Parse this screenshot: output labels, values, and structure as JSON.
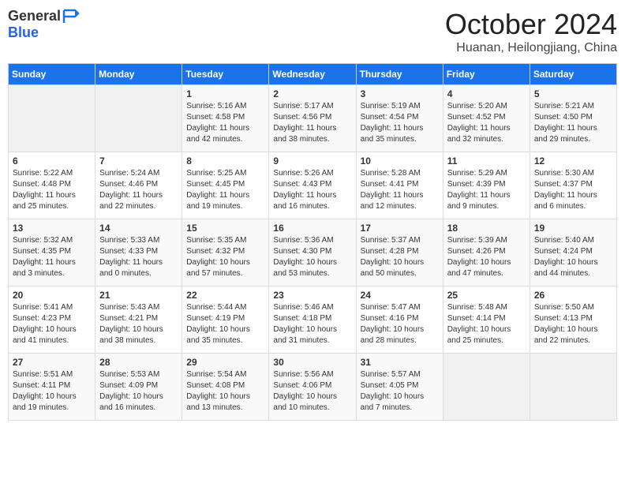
{
  "logo": {
    "general": "General",
    "blue": "Blue"
  },
  "title": "October 2024",
  "subtitle": "Huanan, Heilongjiang, China",
  "headers": [
    "Sunday",
    "Monday",
    "Tuesday",
    "Wednesday",
    "Thursday",
    "Friday",
    "Saturday"
  ],
  "weeks": [
    [
      {
        "day": "",
        "info": ""
      },
      {
        "day": "",
        "info": ""
      },
      {
        "day": "1",
        "info": "Sunrise: 5:16 AM\nSunset: 4:58 PM\nDaylight: 11 hours and 42 minutes."
      },
      {
        "day": "2",
        "info": "Sunrise: 5:17 AM\nSunset: 4:56 PM\nDaylight: 11 hours and 38 minutes."
      },
      {
        "day": "3",
        "info": "Sunrise: 5:19 AM\nSunset: 4:54 PM\nDaylight: 11 hours and 35 minutes."
      },
      {
        "day": "4",
        "info": "Sunrise: 5:20 AM\nSunset: 4:52 PM\nDaylight: 11 hours and 32 minutes."
      },
      {
        "day": "5",
        "info": "Sunrise: 5:21 AM\nSunset: 4:50 PM\nDaylight: 11 hours and 29 minutes."
      }
    ],
    [
      {
        "day": "6",
        "info": "Sunrise: 5:22 AM\nSunset: 4:48 PM\nDaylight: 11 hours and 25 minutes."
      },
      {
        "day": "7",
        "info": "Sunrise: 5:24 AM\nSunset: 4:46 PM\nDaylight: 11 hours and 22 minutes."
      },
      {
        "day": "8",
        "info": "Sunrise: 5:25 AM\nSunset: 4:45 PM\nDaylight: 11 hours and 19 minutes."
      },
      {
        "day": "9",
        "info": "Sunrise: 5:26 AM\nSunset: 4:43 PM\nDaylight: 11 hours and 16 minutes."
      },
      {
        "day": "10",
        "info": "Sunrise: 5:28 AM\nSunset: 4:41 PM\nDaylight: 11 hours and 12 minutes."
      },
      {
        "day": "11",
        "info": "Sunrise: 5:29 AM\nSunset: 4:39 PM\nDaylight: 11 hours and 9 minutes."
      },
      {
        "day": "12",
        "info": "Sunrise: 5:30 AM\nSunset: 4:37 PM\nDaylight: 11 hours and 6 minutes."
      }
    ],
    [
      {
        "day": "13",
        "info": "Sunrise: 5:32 AM\nSunset: 4:35 PM\nDaylight: 11 hours and 3 minutes."
      },
      {
        "day": "14",
        "info": "Sunrise: 5:33 AM\nSunset: 4:33 PM\nDaylight: 11 hours and 0 minutes."
      },
      {
        "day": "15",
        "info": "Sunrise: 5:35 AM\nSunset: 4:32 PM\nDaylight: 10 hours and 57 minutes."
      },
      {
        "day": "16",
        "info": "Sunrise: 5:36 AM\nSunset: 4:30 PM\nDaylight: 10 hours and 53 minutes."
      },
      {
        "day": "17",
        "info": "Sunrise: 5:37 AM\nSunset: 4:28 PM\nDaylight: 10 hours and 50 minutes."
      },
      {
        "day": "18",
        "info": "Sunrise: 5:39 AM\nSunset: 4:26 PM\nDaylight: 10 hours and 47 minutes."
      },
      {
        "day": "19",
        "info": "Sunrise: 5:40 AM\nSunset: 4:24 PM\nDaylight: 10 hours and 44 minutes."
      }
    ],
    [
      {
        "day": "20",
        "info": "Sunrise: 5:41 AM\nSunset: 4:23 PM\nDaylight: 10 hours and 41 minutes."
      },
      {
        "day": "21",
        "info": "Sunrise: 5:43 AM\nSunset: 4:21 PM\nDaylight: 10 hours and 38 minutes."
      },
      {
        "day": "22",
        "info": "Sunrise: 5:44 AM\nSunset: 4:19 PM\nDaylight: 10 hours and 35 minutes."
      },
      {
        "day": "23",
        "info": "Sunrise: 5:46 AM\nSunset: 4:18 PM\nDaylight: 10 hours and 31 minutes."
      },
      {
        "day": "24",
        "info": "Sunrise: 5:47 AM\nSunset: 4:16 PM\nDaylight: 10 hours and 28 minutes."
      },
      {
        "day": "25",
        "info": "Sunrise: 5:48 AM\nSunset: 4:14 PM\nDaylight: 10 hours and 25 minutes."
      },
      {
        "day": "26",
        "info": "Sunrise: 5:50 AM\nSunset: 4:13 PM\nDaylight: 10 hours and 22 minutes."
      }
    ],
    [
      {
        "day": "27",
        "info": "Sunrise: 5:51 AM\nSunset: 4:11 PM\nDaylight: 10 hours and 19 minutes."
      },
      {
        "day": "28",
        "info": "Sunrise: 5:53 AM\nSunset: 4:09 PM\nDaylight: 10 hours and 16 minutes."
      },
      {
        "day": "29",
        "info": "Sunrise: 5:54 AM\nSunset: 4:08 PM\nDaylight: 10 hours and 13 minutes."
      },
      {
        "day": "30",
        "info": "Sunrise: 5:56 AM\nSunset: 4:06 PM\nDaylight: 10 hours and 10 minutes."
      },
      {
        "day": "31",
        "info": "Sunrise: 5:57 AM\nSunset: 4:05 PM\nDaylight: 10 hours and 7 minutes."
      },
      {
        "day": "",
        "info": ""
      },
      {
        "day": "",
        "info": ""
      }
    ]
  ]
}
